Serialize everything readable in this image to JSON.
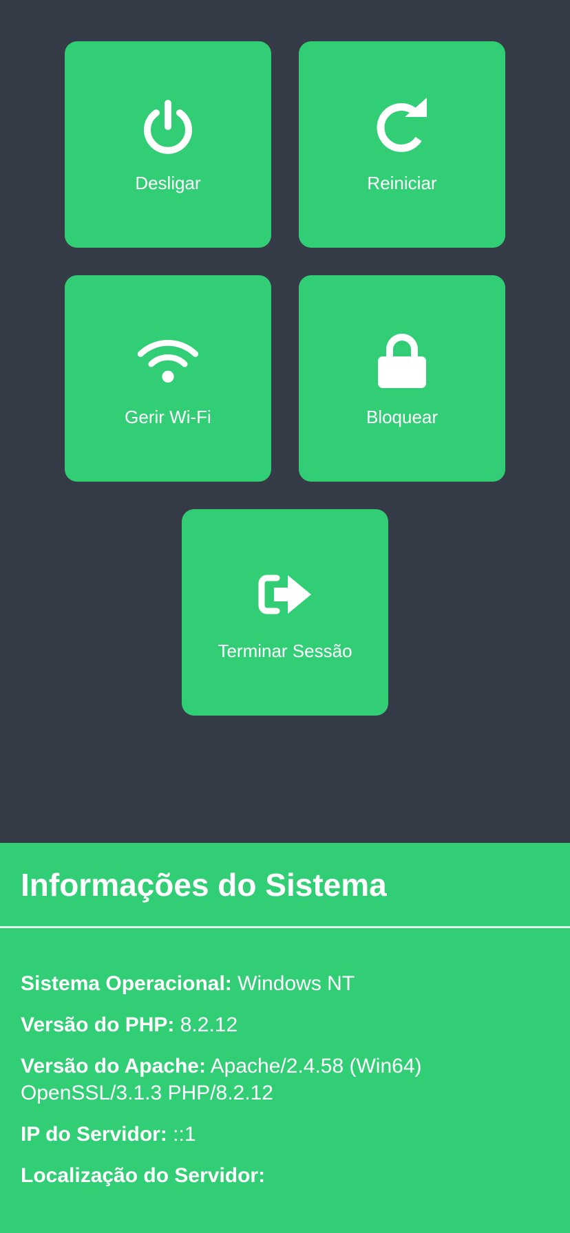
{
  "actions": {
    "shutdown": {
      "label": "Desligar",
      "icon": "power-icon"
    },
    "restart": {
      "label": "Reiniciar",
      "icon": "restart-icon"
    },
    "wifi": {
      "label": "Gerir Wi-Fi",
      "icon": "wifi-icon"
    },
    "lock": {
      "label": "Bloquear",
      "icon": "lock-icon"
    },
    "logout": {
      "label": "Terminar Sessão",
      "icon": "logout-icon"
    }
  },
  "system_info": {
    "title": "Informações do Sistema",
    "os_label": "Sistema Operacional:",
    "os_value": "Windows NT",
    "php_label": "Versão do PHP:",
    "php_value": "8.2.12",
    "apache_label": "Versão do Apache:",
    "apache_value": "Apache/2.4.58 (Win64) OpenSSL/3.1.3 PHP/8.2.12",
    "ip_label": "IP do Servidor:",
    "ip_value": "::1",
    "location_label": "Localização do Servidor:",
    "location_value": ""
  },
  "colors": {
    "background": "#343a46",
    "accent": "#31ce76",
    "text": "#ffffff"
  }
}
